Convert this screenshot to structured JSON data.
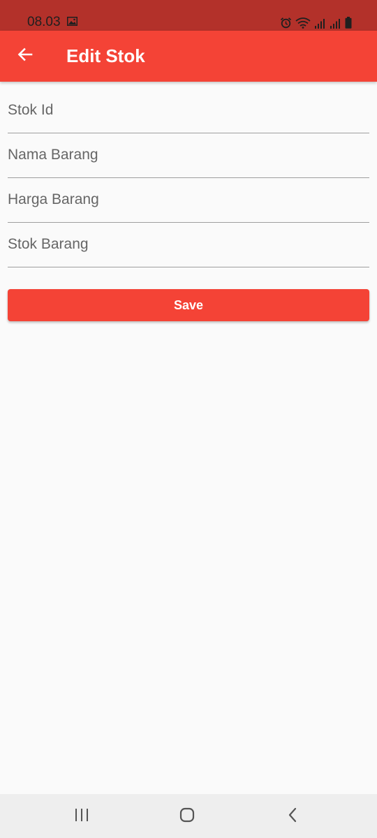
{
  "status_bar": {
    "time": "08.03",
    "icons": [
      "gallery-icon",
      "alarm-icon",
      "wifi-icon",
      "signal-icon",
      "signal-icon",
      "battery-icon"
    ]
  },
  "app_bar": {
    "title": "Edit Stok",
    "back_icon": "arrow-back-icon"
  },
  "form": {
    "fields": [
      {
        "placeholder": "Stok Id",
        "value": ""
      },
      {
        "placeholder": "Nama Barang",
        "value": ""
      },
      {
        "placeholder": "Harga Barang",
        "value": ""
      },
      {
        "placeholder": "Stok Barang",
        "value": ""
      }
    ],
    "save_label": "Save"
  },
  "nav_bar": {
    "buttons": [
      "recents-icon",
      "home-icon",
      "back-icon"
    ]
  },
  "colors": {
    "primary": "#f44336",
    "status_bar": "#b3312a",
    "background": "#fafafa",
    "nav_bar": "#eeeeee"
  }
}
